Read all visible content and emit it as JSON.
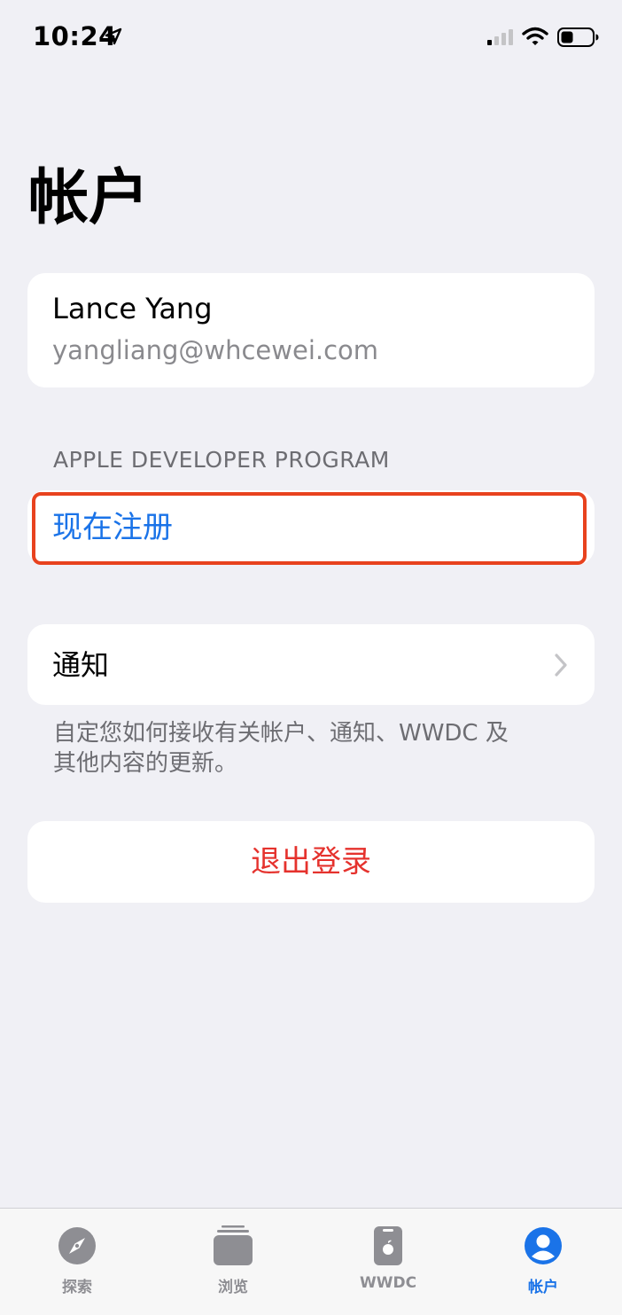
{
  "status_bar": {
    "time": "10:24"
  },
  "page": {
    "title": "帐户"
  },
  "profile": {
    "name": "Lance Yang",
    "email": "yangliang@whcewei.com"
  },
  "developer_program": {
    "header": "APPLE DEVELOPER PROGRAM",
    "enroll_label": "现在注册"
  },
  "notifications": {
    "label": "通知",
    "footer_line1": "自定您如何接收有关帐户、通知、WWDC 及",
    "footer_line2": "其他内容的更新。"
  },
  "sign_out": {
    "label": "退出登录"
  },
  "tab_bar": {
    "tabs": [
      {
        "label": "探索",
        "icon": "compass-icon",
        "active": false
      },
      {
        "label": "浏览",
        "icon": "stack-icon",
        "active": false
      },
      {
        "label": "WWDC",
        "icon": "device-icon",
        "active": false
      },
      {
        "label": "帐户",
        "icon": "person-circle-icon",
        "active": true
      }
    ]
  },
  "colors": {
    "accent": "#1a73e8",
    "destructive": "#e5322d",
    "highlight": "#e8421e",
    "background": "#f0f0f5"
  }
}
